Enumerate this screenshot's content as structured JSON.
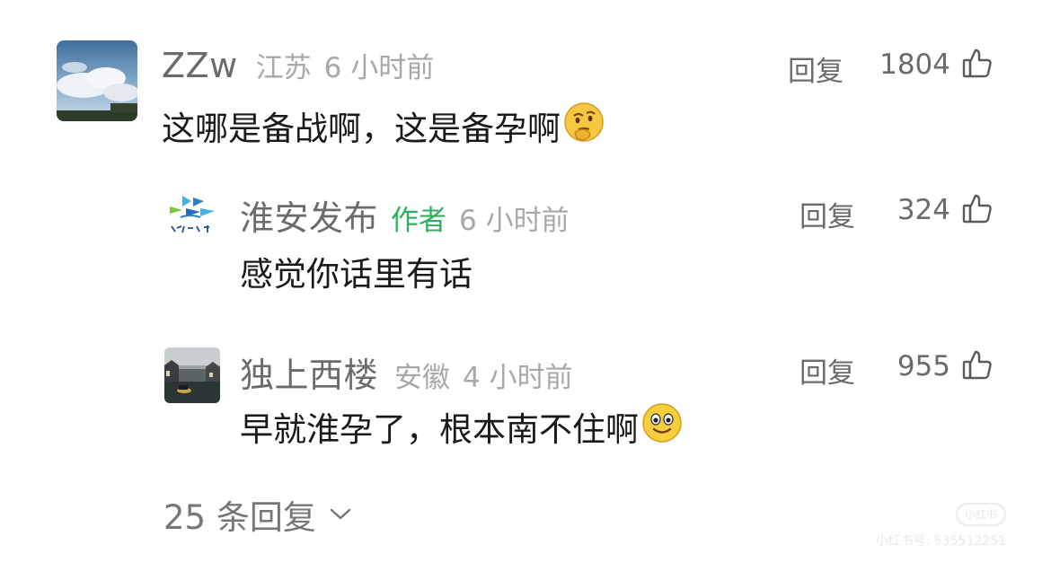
{
  "comments": [
    {
      "username": "ZZw",
      "location": "江苏",
      "time": "6 小时前",
      "text": "这哪是备战啊，这是备孕啊",
      "emoji": "thinking-face-emoji",
      "reply_label": "回复",
      "likes": "1804",
      "like_icon": "thumbs-up-icon"
    }
  ],
  "replies": [
    {
      "username": "淮安发布",
      "author_tag": "作者",
      "time": "6 小时前",
      "text": "感觉你话里有话",
      "reply_label": "回复",
      "likes": "324",
      "like_icon": "thumbs-up-icon"
    },
    {
      "username": "独上西楼",
      "location": "安徽",
      "time": "4 小时前",
      "text": "早就淮孕了，根本南不住啊",
      "emoji": "smiling-face-emoji",
      "reply_label": "回复",
      "likes": "955",
      "like_icon": "thumbs-up-icon"
    }
  ],
  "more_replies": {
    "label": "25 条回复",
    "icon": "chevron-down-icon"
  },
  "watermark": {
    "logo": "小红书",
    "id_text": "小红书号: 535512251"
  },
  "colors": {
    "author_tag": "#2fb05e",
    "username": "#6b6b6b",
    "meta": "#a8a8a8",
    "text": "#1a1a1a"
  }
}
